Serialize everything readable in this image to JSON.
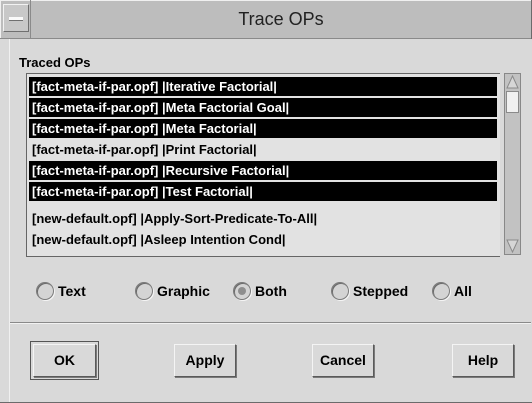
{
  "window": {
    "title": "Trace OPs"
  },
  "list": {
    "label": "Traced OPs",
    "items": [
      {
        "text": "[fact-meta-if-par.opf] |Iterative Factorial|",
        "selected": true
      },
      {
        "text": "[fact-meta-if-par.opf] |Meta Factorial Goal|",
        "selected": true
      },
      {
        "text": "[fact-meta-if-par.opf] |Meta Factorial|",
        "selected": true
      },
      {
        "text": "[fact-meta-if-par.opf] |Print Factorial|",
        "selected": false
      },
      {
        "text": "[fact-meta-if-par.opf] |Recursive Factorial|",
        "selected": true
      },
      {
        "text": "[fact-meta-if-par.opf] |Test Factorial|",
        "selected": true
      },
      {
        "text": "[new-default.opf] |Apply-Sort-Predicate-To-All|",
        "selected": false
      },
      {
        "text": "[new-default.opf] |Asleep Intention Cond|",
        "selected": false
      }
    ]
  },
  "options": {
    "selected": "Both",
    "items": [
      {
        "label": "Text"
      },
      {
        "label": "Graphic"
      },
      {
        "label": "Both"
      },
      {
        "label": "Stepped"
      },
      {
        "label": "All"
      }
    ]
  },
  "buttons": {
    "ok": "OK",
    "apply": "Apply",
    "cancel": "Cancel",
    "help": "Help"
  }
}
